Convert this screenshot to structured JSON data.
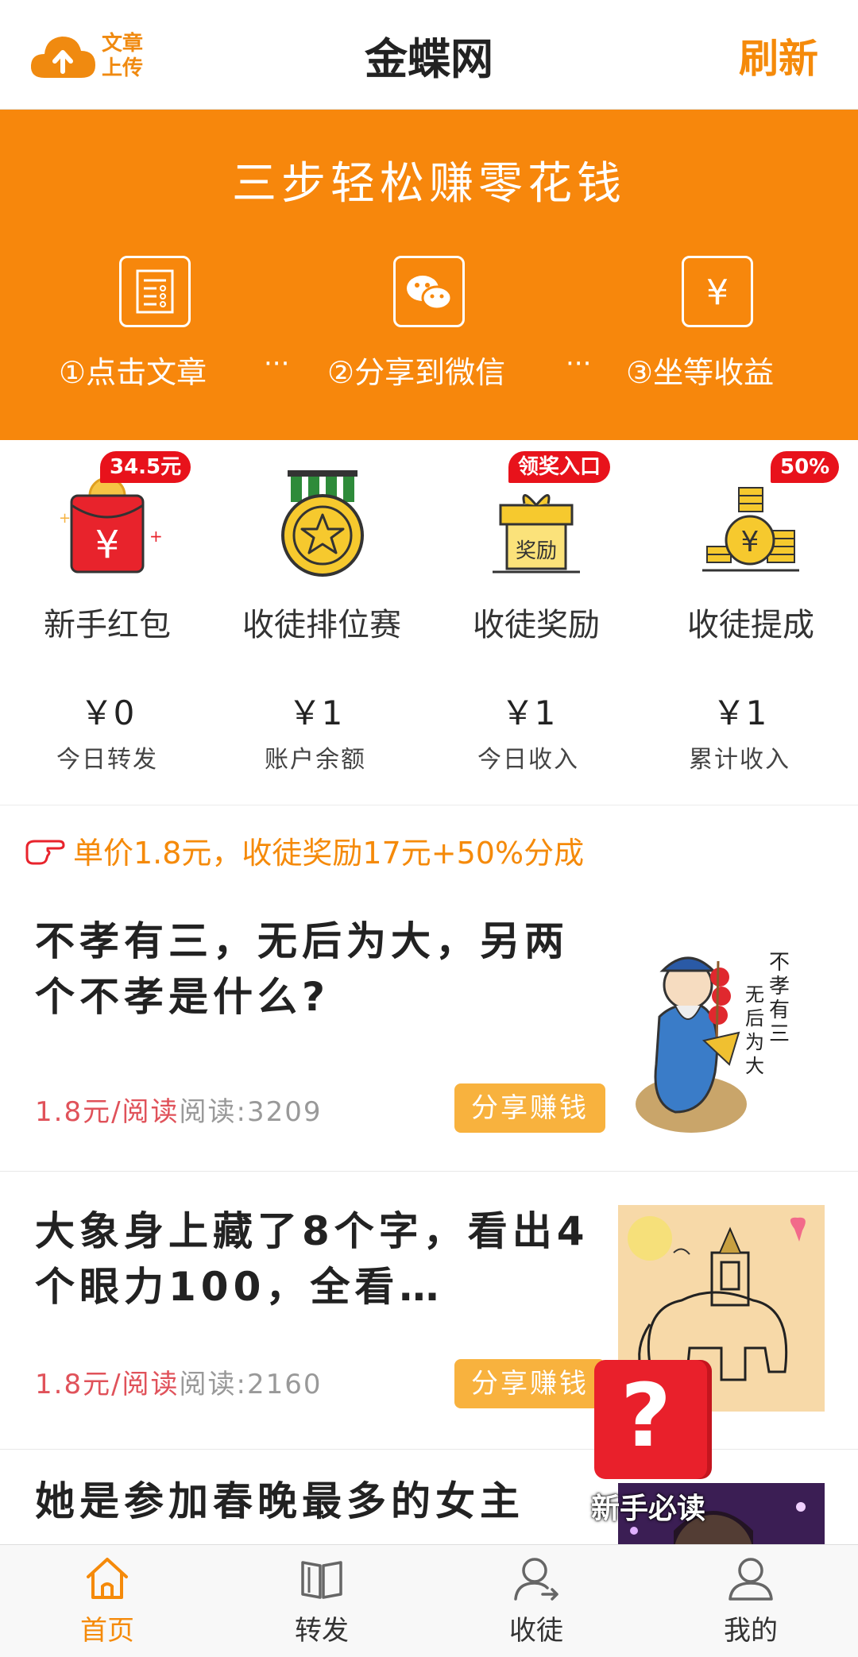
{
  "header": {
    "upload_label": "文章\n上传",
    "title": "金蝶网",
    "refresh": "刷新"
  },
  "banner": {
    "slogan": "三步轻松赚零花钱",
    "steps": [
      {
        "label": "①点击文章",
        "icon": "list-icon"
      },
      {
        "label": "②分享到微信",
        "icon": "wechat-icon"
      },
      {
        "label": "③坐等收益",
        "icon": "yuan-icon"
      }
    ],
    "separator": "···"
  },
  "features": [
    {
      "label": "新手红包",
      "badge": "34.5元",
      "icon": "red-envelope-icon"
    },
    {
      "label": "收徒排位赛",
      "badge": "",
      "icon": "medal-icon"
    },
    {
      "label": "收徒奖励",
      "badge": "领奖入口",
      "icon": "gift-icon"
    },
    {
      "label": "收徒提成",
      "badge": "50%",
      "icon": "coins-icon"
    }
  ],
  "stats": [
    {
      "amount": "￥0",
      "label": "今日转发"
    },
    {
      "amount": "￥1",
      "label": "账户余额"
    },
    {
      "amount": "￥1",
      "label": "今日收入"
    },
    {
      "amount": "￥1",
      "label": "累计收入"
    }
  ],
  "promo": "单价1.8元，收徒奖励17元+50%分成",
  "articles": [
    {
      "title": "不孝有三，无后为大，另两个不孝是什么?",
      "price": "1.8元/阅读",
      "reads": "阅读:3209",
      "share": "分享赚钱"
    },
    {
      "title": "大象身上藏了8个字，看出4个眼力100，全看…",
      "price": "1.8元/阅读",
      "reads": "阅读:2160",
      "share": "分享赚钱"
    },
    {
      "title": "她是参加春晚最多的女主",
      "price": "",
      "reads": "",
      "share": ""
    }
  ],
  "help": {
    "label": "新手必读",
    "symbol": "?"
  },
  "nav": [
    {
      "label": "首页",
      "icon": "home-icon",
      "active": true
    },
    {
      "label": "转发",
      "icon": "book-icon",
      "active": false
    },
    {
      "label": "收徒",
      "icon": "user-share-icon",
      "active": false
    },
    {
      "label": "我的",
      "icon": "person-icon",
      "active": false
    }
  ],
  "colors": {
    "accent": "#f7870c",
    "badge": "#e8121b",
    "price": "#e0525a",
    "share_button": "#f8b23e"
  }
}
